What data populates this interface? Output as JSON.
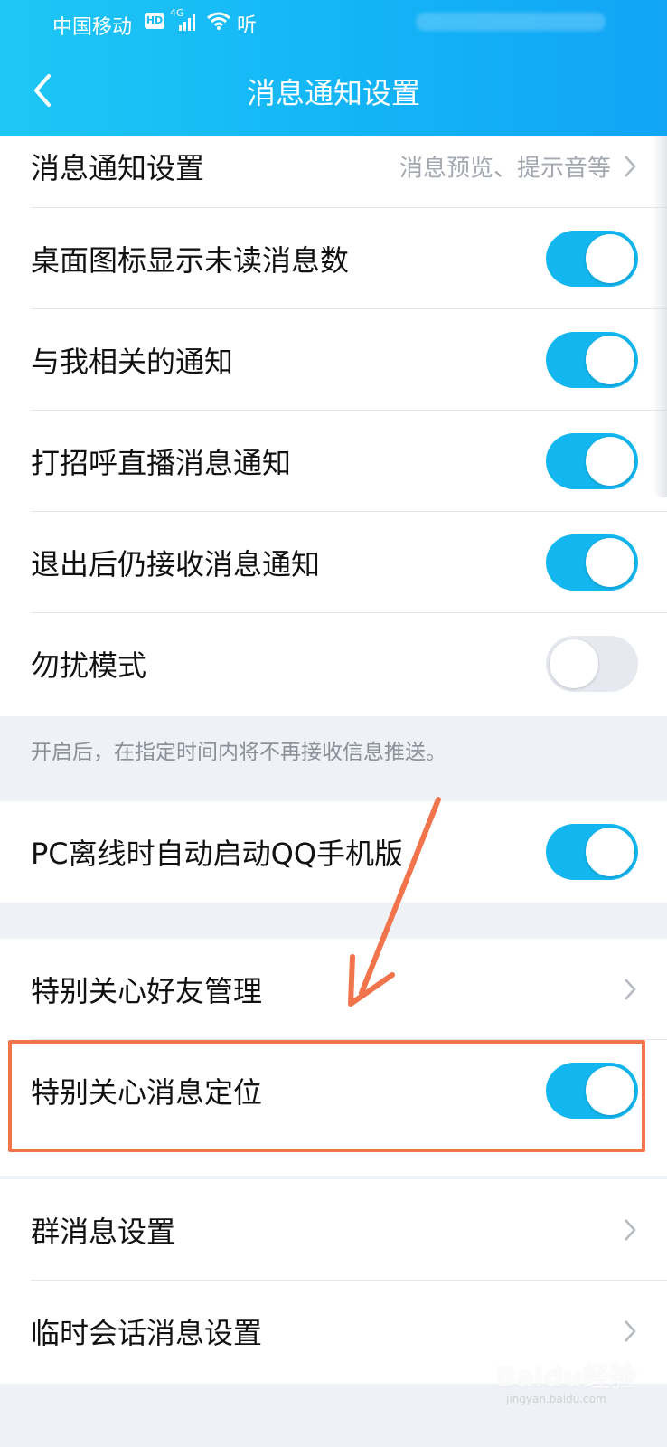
{
  "status_bar": {
    "carrier": "中国移动",
    "hd_badge": "HD",
    "network_type": "4G",
    "listen_glyph": "听"
  },
  "header": {
    "title": "消息通知设置",
    "back_icon": "chevron-left-icon"
  },
  "colors": {
    "header_gradient_start": "#1ec7f5",
    "header_gradient_end": "#12a5f6",
    "toggle_on": "#13b6ef",
    "toggle_off": "#e6e9ef",
    "highlight": "#f2744c",
    "page_background": "#eef1f6"
  },
  "settings": {
    "notification_settings": {
      "label": "消息通知设置",
      "value": "消息预览、提示音等"
    },
    "badge_count": {
      "label": "桌面图标显示未读消息数",
      "enabled": true
    },
    "related_notifications": {
      "label": "与我相关的通知",
      "enabled": true
    },
    "greeting_live": {
      "label": "打招呼直播消息通知",
      "enabled": true
    },
    "receive_after_logout": {
      "label": "退出后仍接收消息通知",
      "enabled": true
    },
    "do_not_disturb": {
      "label": "勿扰模式",
      "enabled": false
    },
    "dnd_note": "开启后，在指定时间内将不再接收信息推送。",
    "pc_offline": {
      "label": "PC离线时自动启动QQ手机版",
      "enabled": true
    },
    "special_care_manage": {
      "label": "特别关心好友管理"
    },
    "special_care_locate": {
      "label": "特别关心消息定位",
      "enabled": true
    },
    "group_settings": {
      "label": "群消息设置"
    },
    "temp_chat_settings": {
      "label": "临时会话消息设置"
    }
  },
  "watermark": {
    "brand": "Baidu经验",
    "url": "jingyan.baidu.com"
  }
}
